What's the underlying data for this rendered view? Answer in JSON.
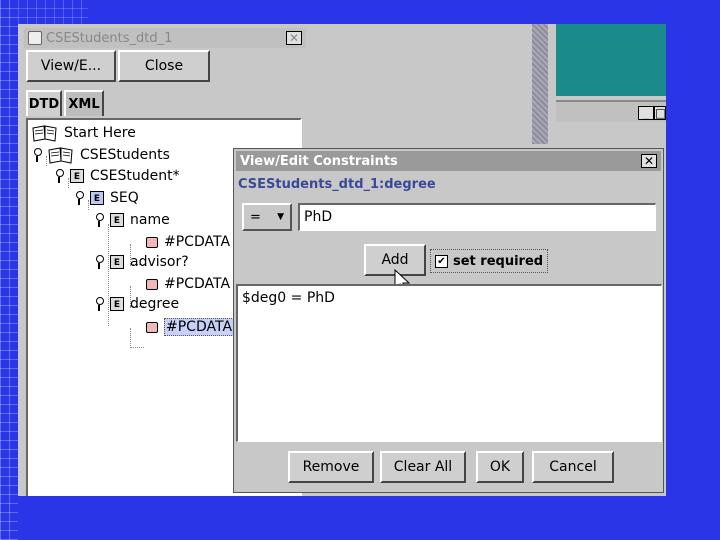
{
  "main_window": {
    "title": "CSEStudents_dtd_1",
    "buttons": {
      "view": "View/E...",
      "close": "Close"
    },
    "tabs": [
      "DTD",
      "XML"
    ],
    "tree": {
      "root": "Start Here",
      "nodes": [
        {
          "label": "CSEStudents",
          "icon": "book-icon"
        },
        {
          "label": "CSEStudent*",
          "icon": "element-icon"
        },
        {
          "label": "SEQ",
          "icon": "seq-icon"
        },
        {
          "label": "name",
          "icon": "element-icon"
        },
        {
          "label": "#PCDATA",
          "icon": "pcdata-icon"
        },
        {
          "label": "advisor?",
          "icon": "element-icon"
        },
        {
          "label": "#PCDATA",
          "icon": "pcdata-icon"
        },
        {
          "label": "degree",
          "icon": "element-icon"
        },
        {
          "label": "#PCDATA",
          "icon": "pcdata-icon",
          "selected": true
        }
      ]
    }
  },
  "dialog": {
    "title": "View/Edit Constraints",
    "subtitle": "CSEStudents_dtd_1:degree",
    "operator": "=",
    "value": "PhD",
    "add_label": "Add",
    "set_required_label": "set required",
    "set_required_checked": true,
    "constraint_text": "$deg0 = PhD",
    "footer_buttons": {
      "remove": "Remove",
      "clear_all": "Clear All",
      "ok": "OK",
      "cancel": "Cancel"
    }
  },
  "colors": {
    "slide_background": "#2a35e8",
    "teal_window": "#1a8a8a",
    "selection": "#c8d0f8"
  }
}
